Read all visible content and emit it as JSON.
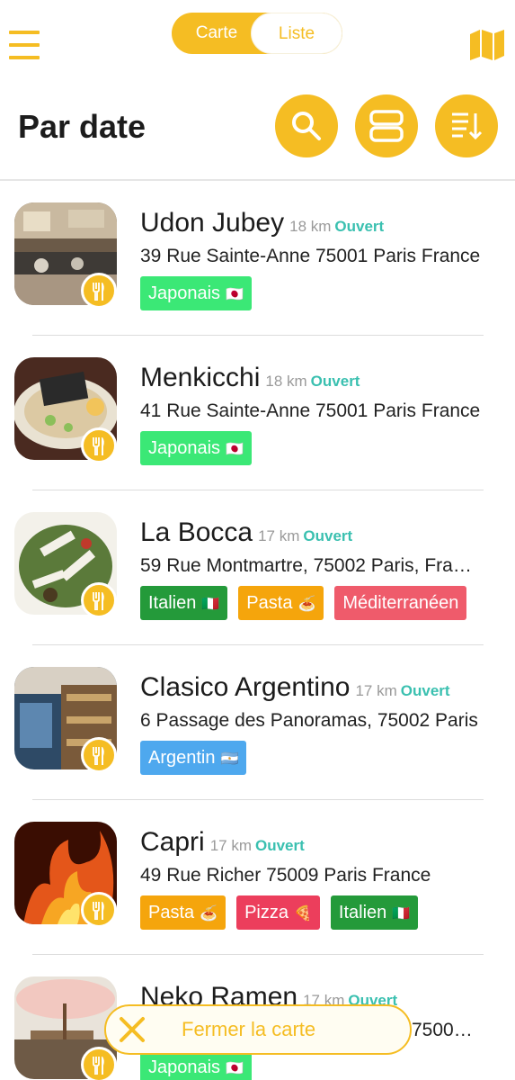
{
  "header": {
    "segment_active": "Carte",
    "segment_inactive": "Liste",
    "icons": {
      "menu": "hamburger-icon",
      "map": "map-icon"
    }
  },
  "page_title": "Par date",
  "actions": {
    "search": "search-icon",
    "layout": "layout-toggle-icon",
    "sort": "sort-icon"
  },
  "colors": {
    "accent": "#f5bd23",
    "open": "#3ac0b0",
    "japonais": "#3be876",
    "italien": "#249a3a",
    "pasta": "#f5a50c",
    "mediterraneen": "#ef5b6b",
    "argentin": "#4ea8ee",
    "pizza": "#ec3e5c"
  },
  "restaurants": [
    {
      "name": "Udon Jubey",
      "distance": "18 km",
      "status": "Ouvert",
      "address": "39 Rue Sainte-Anne 75001 Paris France",
      "tags": [
        {
          "label": "Japonais",
          "flag": "🇯🇵",
          "color": "#3be876"
        }
      ]
    },
    {
      "name": "Menkicchi",
      "distance": "18 km",
      "status": "Ouvert",
      "address": "41 Rue Sainte-Anne 75001 Paris France",
      "tags": [
        {
          "label": "Japonais",
          "flag": "🇯🇵",
          "color": "#3be876"
        }
      ]
    },
    {
      "name": "La Bocca",
      "distance": "17 km",
      "status": "Ouvert",
      "address": "59 Rue Montmartre, 75002 Paris, France",
      "tags": [
        {
          "label": "Italien",
          "flag": "🇮🇹",
          "color": "#249a3a"
        },
        {
          "label": "Pasta",
          "flag": "🍝",
          "color": "#f5a50c"
        },
        {
          "label": "Méditerranéen",
          "flag": "",
          "color": "#ef5b6b"
        }
      ]
    },
    {
      "name": "Clasico Argentino",
      "distance": "17 km",
      "status": "Ouvert",
      "address": "6 Passage des Panoramas, 75002 Paris",
      "tags": [
        {
          "label": "Argentin",
          "flag": "🇦🇷",
          "color": "#4ea8ee"
        }
      ]
    },
    {
      "name": "Capri",
      "distance": "17 km",
      "status": "Ouvert",
      "address": "49 Rue Richer 75009 Paris France",
      "tags": [
        {
          "label": "Pasta",
          "flag": "🍝",
          "color": "#f5a50c"
        },
        {
          "label": "Pizza",
          "flag": "🍕",
          "color": "#ec3e5c"
        },
        {
          "label": "Italien",
          "flag": "🇮🇹",
          "color": "#249a3a"
        }
      ]
    },
    {
      "name": "Neko Ramen",
      "distance": "17 km",
      "status": "Ouvert",
      "address": "7500…",
      "tags": [
        {
          "label": "Japonais",
          "flag": "🇯🇵",
          "color": "#3be876"
        }
      ]
    }
  ],
  "close_map": {
    "label": "Fermer la carte",
    "icon": "close-icon"
  }
}
